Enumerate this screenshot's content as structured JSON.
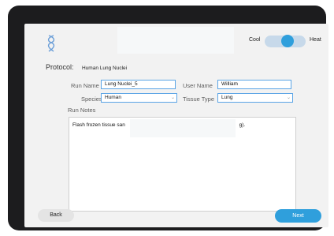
{
  "header": {
    "logo_icon": "dna-helix-logo",
    "toggle": {
      "left_label": "Cool",
      "right_label": "Heat",
      "state": "heat",
      "accent": "#2f9fdc"
    }
  },
  "protocol": {
    "label": "Protocol:",
    "value": "Human Lung Nuclei"
  },
  "form": {
    "run_name_label": "Run Name",
    "run_name_value": "Lung Nuclei_5",
    "user_name_label": "User Name",
    "user_name_value": "William",
    "species_label": "Species",
    "species_value": "Human",
    "tissue_type_label": "Tissue Type",
    "tissue_type_value": "Lung",
    "run_notes_label": "Run Notes",
    "run_notes_value": "Flash frozen tissue san",
    "run_notes_tail": "g)."
  },
  "footer": {
    "back_label": "Back",
    "next_label": "Next"
  },
  "colors": {
    "accent": "#2f9fdc",
    "field_border": "#5aa4e6"
  }
}
